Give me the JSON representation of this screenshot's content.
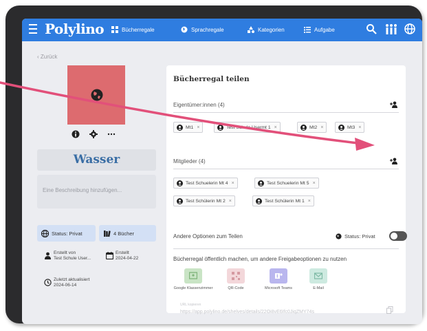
{
  "nav": {
    "logo": "Polylino",
    "items": [
      {
        "label": "Bücherregale",
        "icon": "grid-icon"
      },
      {
        "label": "Sprachregale",
        "icon": "globe-icon"
      },
      {
        "label": "Kategorien",
        "icon": "shapes-icon"
      },
      {
        "label": "Aufgabe",
        "icon": "list-icon"
      }
    ],
    "right_icons": [
      "search-icon",
      "people-icon",
      "language-globe-icon"
    ]
  },
  "back_link": "‹ Zurück",
  "shelf": {
    "title": "Wasser",
    "description_placeholder": "Eine Beschreibung hinzufügen...",
    "avatar_color": "#dd6b6f",
    "status": "Status: Privat",
    "book_count": "4 Bücher",
    "created_by_label": "Erstellt von",
    "created_by_value": "Test Schule User...",
    "created_label": "Erstellt",
    "created_value": "2024-04-22",
    "updated_label": "Zuletzt aktualisiert",
    "updated_value": "2024-06-14"
  },
  "panel": {
    "title": "Bücherregal teilen",
    "owners_label": "Eigentümer:innen (4)",
    "owners": [
      "Mt1",
      "Test Schule Usermt 1",
      "Mt2",
      "Mt3"
    ],
    "members_label": "Mitglieder (4)",
    "members": [
      "Test Schuelerin Mt 4",
      "Test Schuelerin Mt 5",
      "Test Schülerin Mt 2",
      "Test Schülerin Mt 1"
    ],
    "options_label": "Andere Optionen zum Teilen",
    "status": "Status: Privat",
    "public_text": "Bücherregal öffentlich machen, um andere Freigabeoptionen zu nutzen",
    "share_options": [
      {
        "label": "Google Klassenzimmer",
        "color": "#c9e4c5"
      },
      {
        "label": "QR-Code",
        "color": "#f3d7da"
      },
      {
        "label": "Microsoft Teams",
        "color": "#b9b6ee"
      },
      {
        "label": "E-Mail",
        "color": "#cdeae0"
      }
    ],
    "url_label": "URL kopieren",
    "url_value": "https://app.polylino.de/shelves/details/22Oi8vE6Ifc0JiqZMY74s"
  },
  "colors": {
    "nav": "#2f7de0",
    "accent_arrow": "#e2507a"
  }
}
